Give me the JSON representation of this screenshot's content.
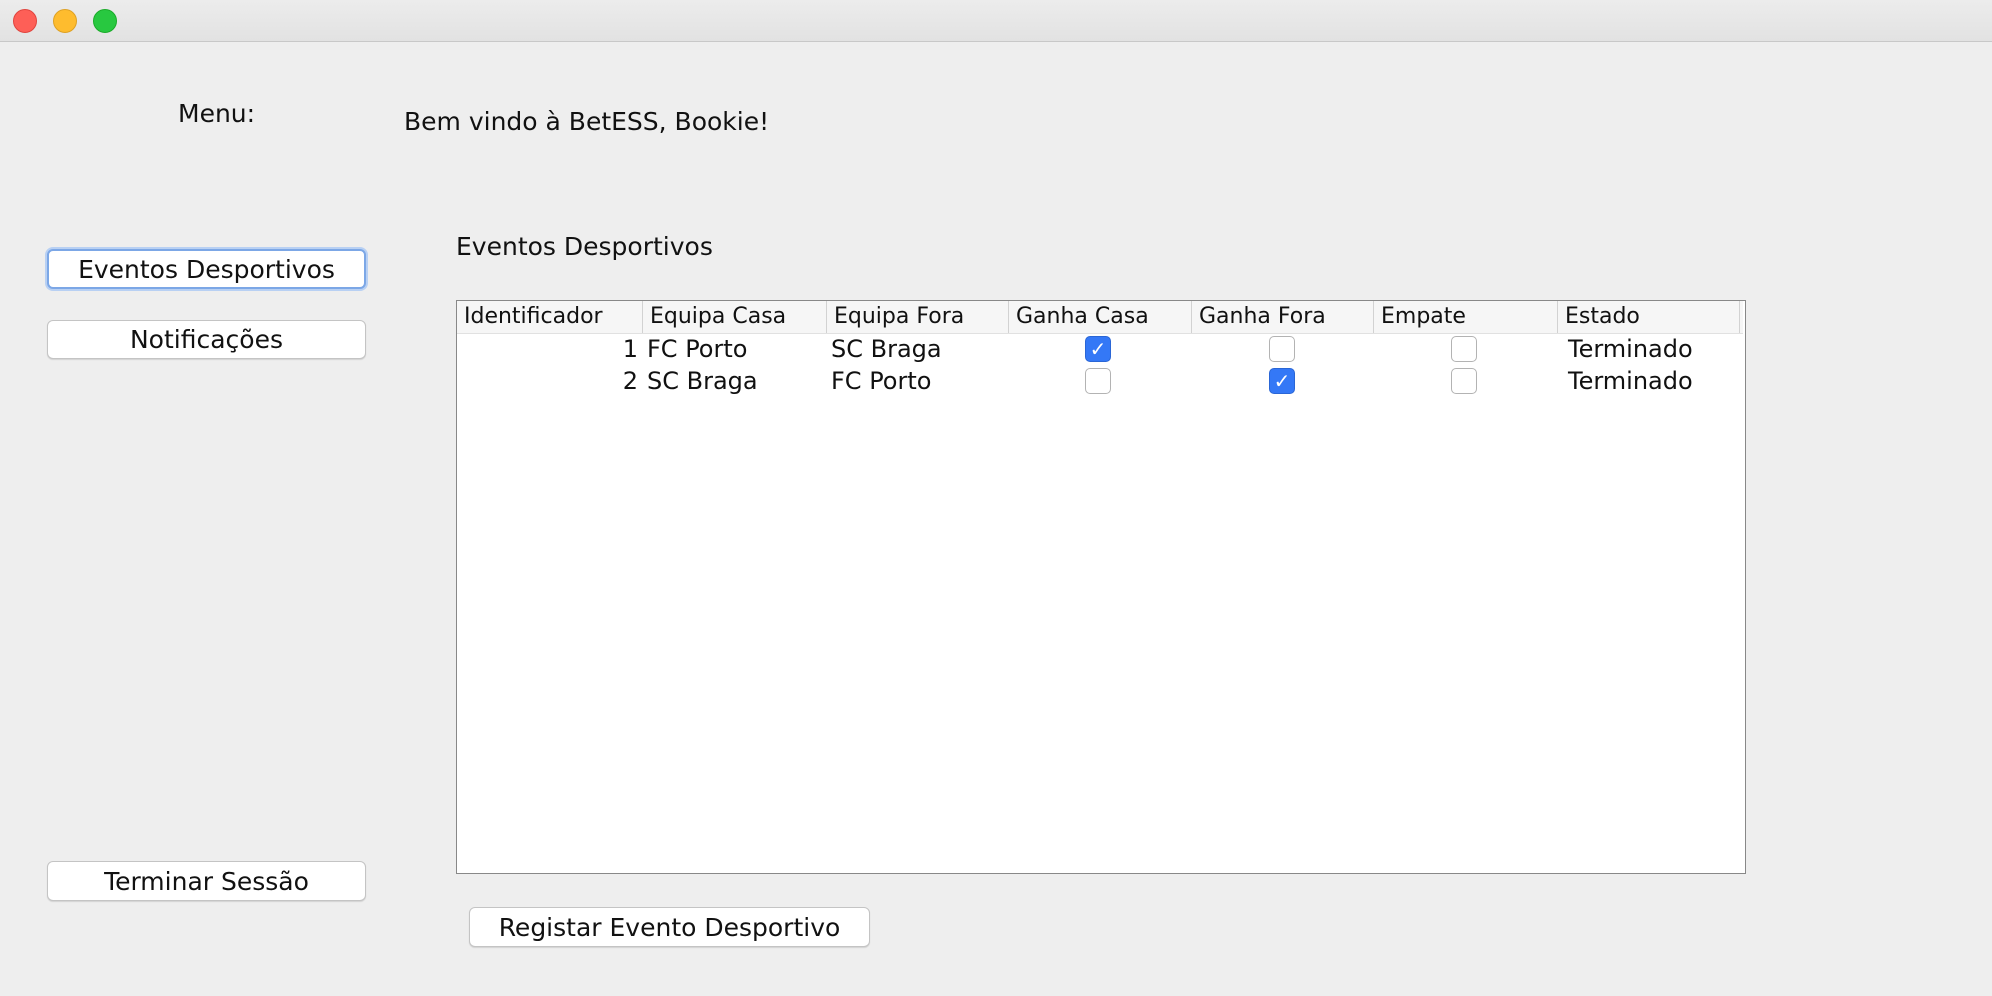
{
  "window": {
    "close_color": "#fe5f57",
    "minimize_color": "#febc2e",
    "maximize_color": "#28c840"
  },
  "header": {
    "menu_label": "Menu:",
    "welcome_text": "Bem vindo à BetESS, Bookie!"
  },
  "sidebar": {
    "eventos_label": "Eventos Desportivos",
    "notificacoes_label": "Notificações",
    "terminar_label": "Terminar Sessão"
  },
  "main": {
    "title": "Eventos Desportivos",
    "register_label": "Registar Evento Desportivo"
  },
  "table": {
    "columns": [
      "Identificador",
      "Equipa Casa",
      "Equipa Fora",
      "Ganha Casa",
      "Ganha Fora",
      "Empate",
      "Estado"
    ],
    "rows": [
      {
        "id": "1",
        "casa": "FC Porto",
        "fora": "SC Braga",
        "ganha_casa": true,
        "ganha_fora": false,
        "empate": false,
        "estado": "Terminado"
      },
      {
        "id": "2",
        "casa": "SC Braga",
        "fora": "FC Porto",
        "ganha_casa": false,
        "ganha_fora": true,
        "empate": false,
        "estado": "Terminado"
      }
    ]
  },
  "colors": {
    "checkbox_checked": "#3478f6",
    "focus_ring": "#7ca7e6"
  }
}
